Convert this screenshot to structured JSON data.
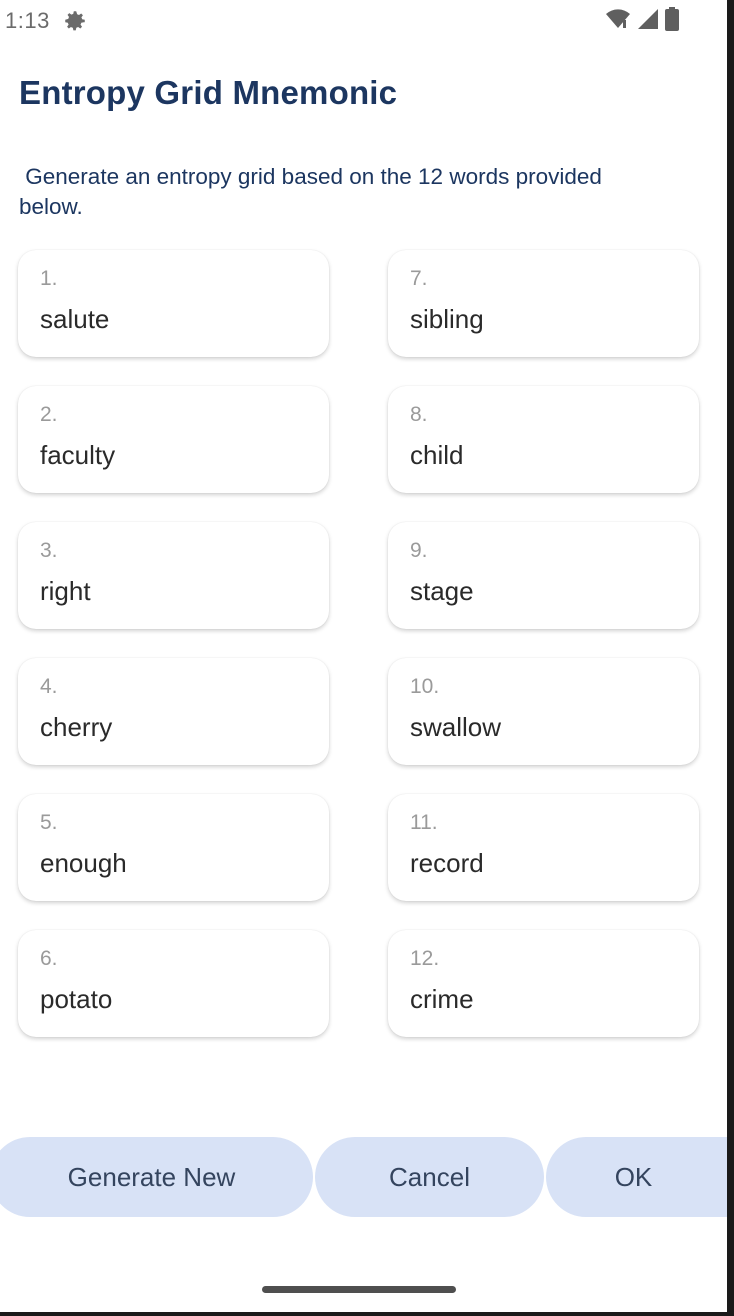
{
  "status_bar": {
    "time": "1:13",
    "icons": [
      "gear-icon",
      "wifi-icon",
      "signal-icon",
      "battery-icon"
    ]
  },
  "page": {
    "title": "Entropy Grid Mnemonic",
    "description": " Generate an entropy grid based on the 12 words provided\nbelow."
  },
  "words": [
    {
      "index": "1.",
      "word": "salute"
    },
    {
      "index": "2.",
      "word": "faculty"
    },
    {
      "index": "3.",
      "word": "right"
    },
    {
      "index": "4.",
      "word": "cherry"
    },
    {
      "index": "5.",
      "word": "enough"
    },
    {
      "index": "6.",
      "word": "potato"
    },
    {
      "index": "7.",
      "word": "sibling"
    },
    {
      "index": "8.",
      "word": "child"
    },
    {
      "index": "9.",
      "word": "stage"
    },
    {
      "index": "10.",
      "word": "swallow"
    },
    {
      "index": "11.",
      "word": "record"
    },
    {
      "index": "12.",
      "word": "crime"
    }
  ],
  "actions": {
    "generate_new": "Generate New",
    "cancel": "Cancel",
    "ok": "OK"
  },
  "colors": {
    "title": "#1c3660",
    "button_bg": "#d8e2f6",
    "button_text": "#34445e"
  }
}
